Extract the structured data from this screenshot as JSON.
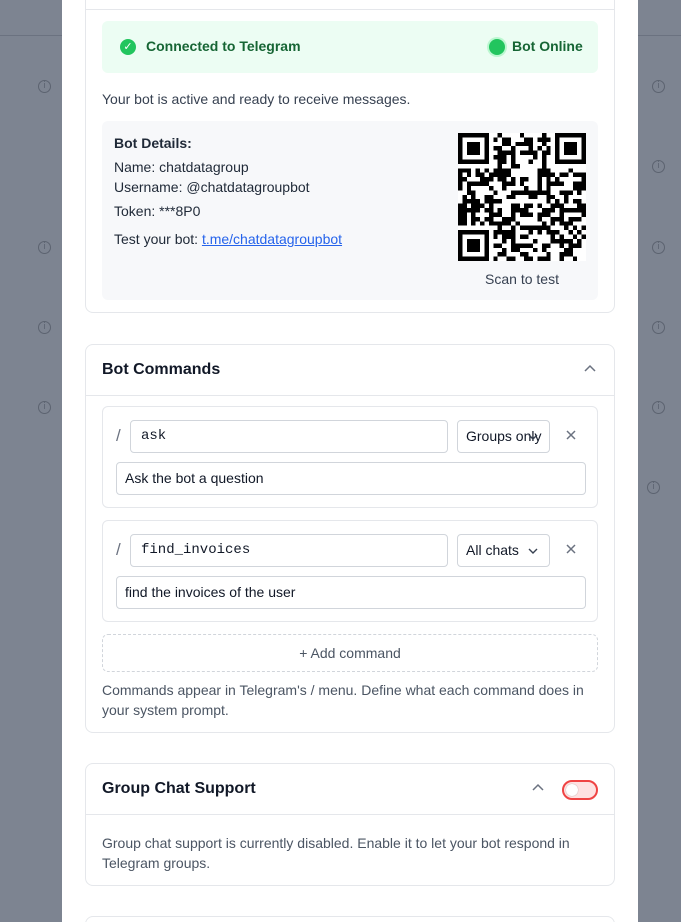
{
  "connection": {
    "status_text": "Connected to Telegram",
    "bot_status": "Bot Online",
    "description": "Your bot is active and ready to receive messages."
  },
  "details": {
    "heading": "Bot Details:",
    "name": "Name: chatdatagroup",
    "username": "Username: @chatdatagroupbot",
    "token": "Token: ***8P0",
    "test_prefix": "Test your bot:",
    "test_link": "t.me/chatdatagroupbot",
    "scan_label": "Scan to test"
  },
  "commands": {
    "title": "Bot Commands",
    "items": [
      {
        "slash": "/",
        "name": "ask",
        "scope": "Groups only",
        "description": "Ask the bot a question"
      },
      {
        "slash": "/",
        "name": "find_invoices",
        "scope": "All chats",
        "description": "find the invoices of the user"
      }
    ],
    "add_label": "+ Add command",
    "help_line1": "Commands appear in Telegram's / menu. Define what each command does in",
    "help_line2": "your system prompt."
  },
  "group_chat": {
    "title": "Group Chat Support",
    "enabled": false,
    "help_line1": "Group chat support is currently disabled. Enable it to let your bot respond in",
    "help_line2": "Telegram groups."
  },
  "colors": {
    "success": "#22c55e",
    "success_bg": "#ecfdf3",
    "link": "#2563eb",
    "toggle_off": "#ef4444"
  }
}
